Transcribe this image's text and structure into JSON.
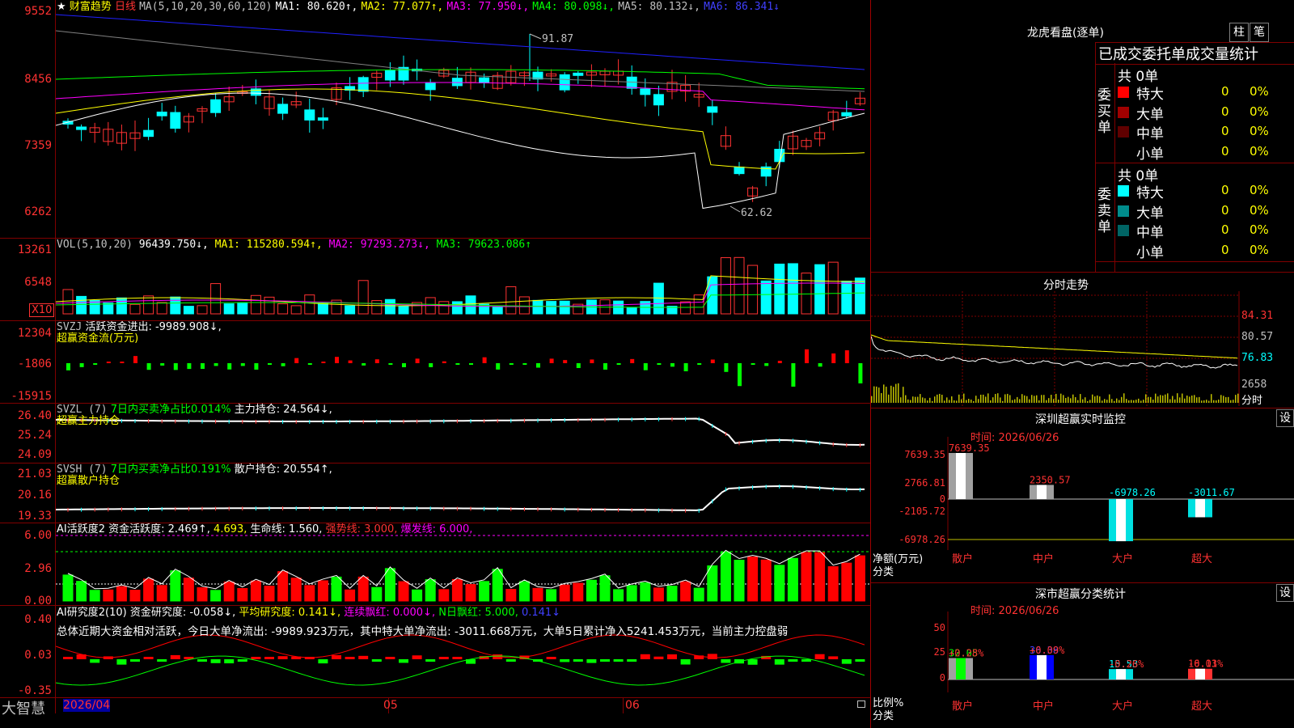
{
  "app": {
    "logo": "大智慧"
  },
  "main_chart": {
    "star": "★",
    "title": "财富趋势",
    "period": "日线",
    "ma_params": "MA(5,10,20,30,60,120)",
    "ma1": "MA1: 80.620↑,",
    "ma2": "MA2: 77.077↑,",
    "ma3": "MA3: 77.950↓,",
    "ma4": "MA4: 80.098↓,",
    "ma5": "MA5: 80.132↓,",
    "ma6": "MA6: 86.341↓",
    "y_labels": [
      "9552",
      "8456",
      "7359",
      "6262"
    ],
    "high_note": "91.87",
    "low_note": "62.62",
    "colors": {
      "up": "#ff3232",
      "down": "#00ffff",
      "ma1": "#ffffff",
      "ma2": "#ffff00",
      "ma3": "#ff00ff",
      "ma4": "#00ff00",
      "ma5": "#808080",
      "ma6": "#2020ff"
    }
  },
  "vol": {
    "params": "VOL(5,10,20)",
    "value": "96439.750↓,",
    "ma1": "MA1: 115280.594↑,",
    "ma2": "MA2: 97293.273↓,",
    "ma3": "MA3: 79623.086↑",
    "y_labels": [
      "13261",
      "6548"
    ],
    "unit": "X10"
  },
  "svzj": {
    "name": "SVZJ",
    "desc": "活跃资金进出: -9989.908↓,",
    "title": "超赢资金流(万元)",
    "y_labels": [
      "12304",
      "-1806",
      "-15915"
    ]
  },
  "svzl": {
    "name": "SVZL (7)",
    "desc": "7日内买卖净占比0.014%",
    "hold": "主力持仓: 24.564↓,",
    "title": "超赢主力持仓",
    "y_labels": [
      "26.40",
      "25.24",
      "24.09"
    ]
  },
  "svsh": {
    "name": "SVSH (7)",
    "desc": "7日内买卖净占比0.191%",
    "hold": "散户持仓: 20.554↑,",
    "title": "超赢散户持仓",
    "y_labels": [
      "21.03",
      "20.16",
      "19.33"
    ]
  },
  "ai_active": {
    "name": "AI活跃度2",
    "desc": "资金活跃度: 2.469↑,",
    "v2": "4.693,",
    "life": "生命线: 1.560,",
    "strong": "强势线: 3.000,",
    "burst": "爆发线: 6.000,",
    "y_labels": [
      "6.00",
      "2.96",
      "0.00"
    ]
  },
  "ai_research": {
    "name": "AI研究度2(10)",
    "desc": "资金研究度: -0.058↓,",
    "avg": "平均研究度: 0.141↓,",
    "cont": "连续飘红: 0.000↓,",
    "nday": "N日飘红: 5.000,",
    "last": "0.141↓",
    "summary": "总体近期大资金相对活跃，今日大单净流出: -9989.923万元，其中特大单净流出: -3011.668万元，大单5日累计净入5241.453万元，当前主力控盘弱",
    "y_labels": [
      "0.40",
      "0.03",
      "-0.35"
    ]
  },
  "x_axis": {
    "labels": [
      "2026/04",
      "05",
      "06"
    ]
  },
  "lhb": {
    "title": "龙虎看盘(逐单)",
    "btn1": "柱",
    "btn2": "笔",
    "header": "已成交委托单成交量统计",
    "buy_label": "委买单",
    "sell_label": "委卖单",
    "buy_total": "共 0单",
    "sell_total": "共 0单",
    "buy_rows": [
      {
        "name": "特大",
        "count": "0",
        "pct": "0%",
        "color": "#ff0000"
      },
      {
        "name": "大单",
        "count": "0",
        "pct": "0%",
        "color": "#a00000"
      },
      {
        "name": "中单",
        "count": "0",
        "pct": "0%",
        "color": "#600000"
      },
      {
        "name": "小单",
        "count": "0",
        "pct": "0%",
        "color": ""
      }
    ],
    "sell_rows": [
      {
        "name": "特大",
        "count": "0",
        "pct": "0%",
        "color": "#00ffff"
      },
      {
        "name": "大单",
        "count": "0",
        "pct": "0%",
        "color": "#008c8c"
      },
      {
        "name": "中单",
        "count": "0",
        "pct": "0%",
        "color": "#006464"
      },
      {
        "name": "小单",
        "count": "0",
        "pct": "0%",
        "color": ""
      }
    ]
  },
  "intraday": {
    "title": "分时走势",
    "y_labels": [
      "84.31",
      "80.57",
      "76.83"
    ],
    "vol_label": "2658",
    "unit": "分时"
  },
  "monitor": {
    "title": "深圳超赢实时监控",
    "set": "设",
    "time": "时间: 2026/06/26",
    "y_labels": [
      "7639.35",
      "2766.81",
      "0",
      "-2105.72",
      "-6978.26"
    ],
    "ylabel": "净额(万元)",
    "xlabel_title": "分类",
    "categories": [
      "散户",
      "中户",
      "大户",
      "超大"
    ],
    "values": [
      7639.35,
      2350.57,
      -6978.26,
      -3011.67
    ],
    "value_labels": [
      "7639.35",
      "2350.57",
      "-6978.26",
      "-3011.67"
    ]
  },
  "classify": {
    "title": "深市超赢分类统计",
    "set": "设",
    "time": "时间: 2026/06/26",
    "y_labels": [
      "75",
      "50",
      "25",
      "0"
    ],
    "ylabel": "比例%",
    "xlabel_title": "分类",
    "categories": [
      "散户",
      "中户",
      "大户",
      "超大"
    ],
    "values": [
      32.05,
      36.38,
      15.53,
      16.03
    ],
    "value_labels": [
      "32.05",
      "36.38",
      "15.53",
      "16.03"
    ],
    "changes": [
      "+0.28%",
      "+0.09%",
      "-0.26%",
      "-0.11%"
    ]
  }
}
